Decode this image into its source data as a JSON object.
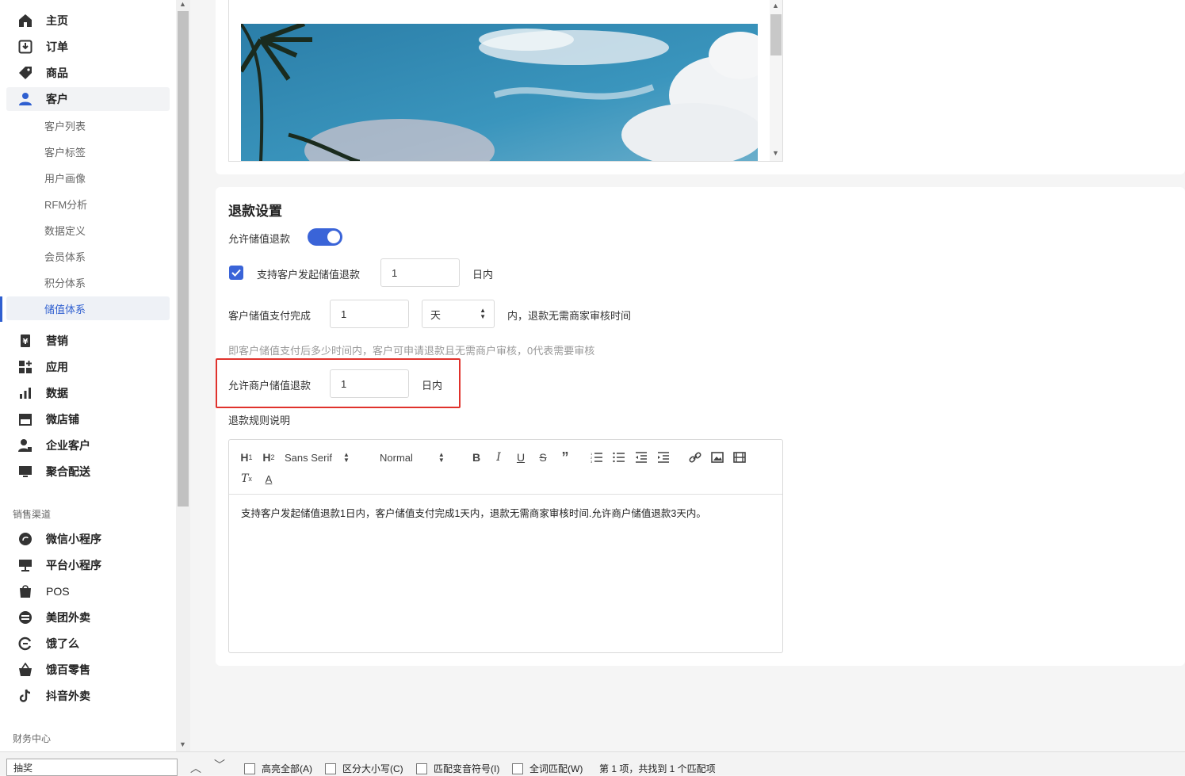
{
  "sidebar": {
    "main_items": [
      {
        "label": "主页",
        "icon": "home-icon"
      },
      {
        "label": "订单",
        "icon": "order-icon"
      },
      {
        "label": "商品",
        "icon": "tag-icon"
      },
      {
        "label": "客户",
        "icon": "user-icon"
      }
    ],
    "sub_items": [
      "客户列表",
      "客户标签",
      "用户画像",
      "RFM分析",
      "数据定义",
      "会员体系",
      "积分体系",
      "储值体系"
    ],
    "more_items": [
      {
        "label": "营销",
        "icon": "yen-icon"
      },
      {
        "label": "应用",
        "icon": "apps-icon"
      },
      {
        "label": "数据",
        "icon": "bar-chart-icon"
      },
      {
        "label": "微店铺",
        "icon": "store-icon"
      },
      {
        "label": "企业客户",
        "icon": "enterprise-user-icon"
      },
      {
        "label": "聚合配送",
        "icon": "monitor-icon"
      }
    ],
    "channel_section": "销售渠道",
    "channel_items": [
      {
        "label": "微信小程序",
        "icon": "wechat-miniprogram-icon"
      },
      {
        "label": "平台小程序",
        "icon": "platform-icon"
      },
      {
        "label": "POS",
        "icon": "pos-bag-icon"
      },
      {
        "label": "美团外卖",
        "icon": "meituan-icon"
      },
      {
        "label": "饿了么",
        "icon": "eleme-icon"
      },
      {
        "label": "饿百零售",
        "icon": "basket-icon"
      },
      {
        "label": "抖音外卖",
        "icon": "tiktok-icon"
      }
    ],
    "finance_section": "财务中心"
  },
  "refund": {
    "title": "退款设置",
    "allow_stored_refund_label": "允许储值退款",
    "allow_stored_refund_on": true,
    "customer_initiate_label": "支持客户发起储值退款",
    "customer_initiate_checked": true,
    "customer_initiate_value": "1",
    "customer_initiate_suffix": "日内",
    "payment_complete_label": "客户储值支付完成",
    "payment_complete_value": "1",
    "payment_unit": "天",
    "payment_suffix": "内，退款无需商家审核时间",
    "hint": "即客户储值支付后多少时间内，客户可申请退款且无需商户审核，0代表需要审核",
    "merchant_refund_label": "允许商户储值退款",
    "merchant_refund_value": "1",
    "merchant_refund_suffix": "日内",
    "rules_label": "退款规则说明",
    "editor": {
      "font": "Sans Serif",
      "size": "Normal",
      "content": "支持客户发起储值退款1日内，客户储值支付完成1天内，退款无需商家审核时间.允许商户储值退款3天内。"
    }
  },
  "colors": {
    "accent": "#3a64d8",
    "highlight": "#e0322c"
  },
  "findbar": {
    "query": "抽奖",
    "options": [
      "高亮全部(A)",
      "区分大小写(C)",
      "匹配变音符号(I)",
      "全词匹配(W)"
    ],
    "result": "第 1 项，共找到 1 个匹配项"
  }
}
